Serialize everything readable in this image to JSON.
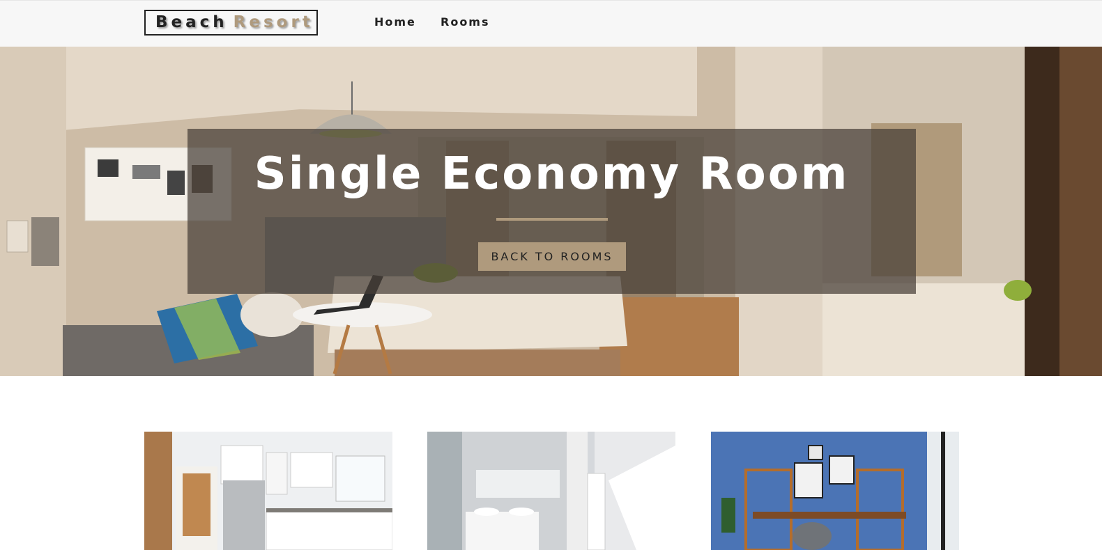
{
  "navbar": {
    "logo_part1": "Beach",
    "logo_part2": "Resort",
    "links": [
      "Home",
      "Rooms"
    ]
  },
  "hero": {
    "title": "Single Economy Room",
    "button_label": "BACK TO ROOMS"
  },
  "colors": {
    "accent": "#af9a7d",
    "text_dark": "#222222",
    "navbar_bg": "#f7f7f7"
  },
  "gallery": [
    "kitchen-photo",
    "bathroom-photo",
    "office-photo"
  ]
}
